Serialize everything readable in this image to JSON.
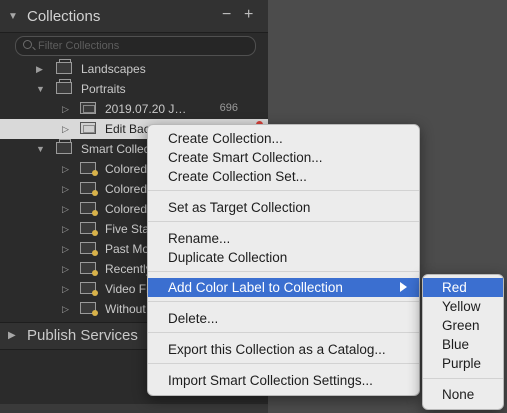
{
  "collections_panel": {
    "title": "Collections",
    "filter_placeholder": "Filter Collections",
    "minus_label": "−",
    "plus_label": "+",
    "items": [
      {
        "label": "Landscapes",
        "expanded": false,
        "type": "set"
      },
      {
        "label": "Portraits",
        "expanded": true,
        "type": "set"
      },
      {
        "label": "2019.07.20 J…",
        "count": "696",
        "type": "collection"
      },
      {
        "label": "Edit Back",
        "type": "collection",
        "selected": true
      },
      {
        "label": "Smart Collec",
        "expanded": true,
        "type": "set"
      },
      {
        "label": "Colored",
        "type": "smart"
      },
      {
        "label": "Colored",
        "type": "smart"
      },
      {
        "label": "Colored",
        "type": "smart"
      },
      {
        "label": "Five Star",
        "type": "smart"
      },
      {
        "label": "Past Mo",
        "type": "smart"
      },
      {
        "label": "Recently",
        "type": "smart"
      },
      {
        "label": "Video Fi",
        "type": "smart"
      },
      {
        "label": "Without",
        "type": "smart"
      }
    ],
    "publish_services": "Publish Services"
  },
  "context_menu": {
    "items": [
      "Create Collection...",
      "Create Smart Collection...",
      "Create Collection Set...",
      "Set as Target Collection",
      "Rename...",
      "Duplicate Collection",
      "Add Color Label to Collection",
      "Delete...",
      "Export this Collection as a Catalog...",
      "Import Smart Collection Settings..."
    ],
    "highlighted": "Add Color Label to Collection"
  },
  "color_submenu": {
    "items": [
      "Red",
      "Yellow",
      "Green",
      "Blue",
      "Purple",
      "None"
    ],
    "highlighted": "Red"
  },
  "colors": {
    "accent": "#3b6fd0",
    "label_red": "#d9403a",
    "panel_bg": "#2b2b2b",
    "menu_bg": "#ececec"
  }
}
